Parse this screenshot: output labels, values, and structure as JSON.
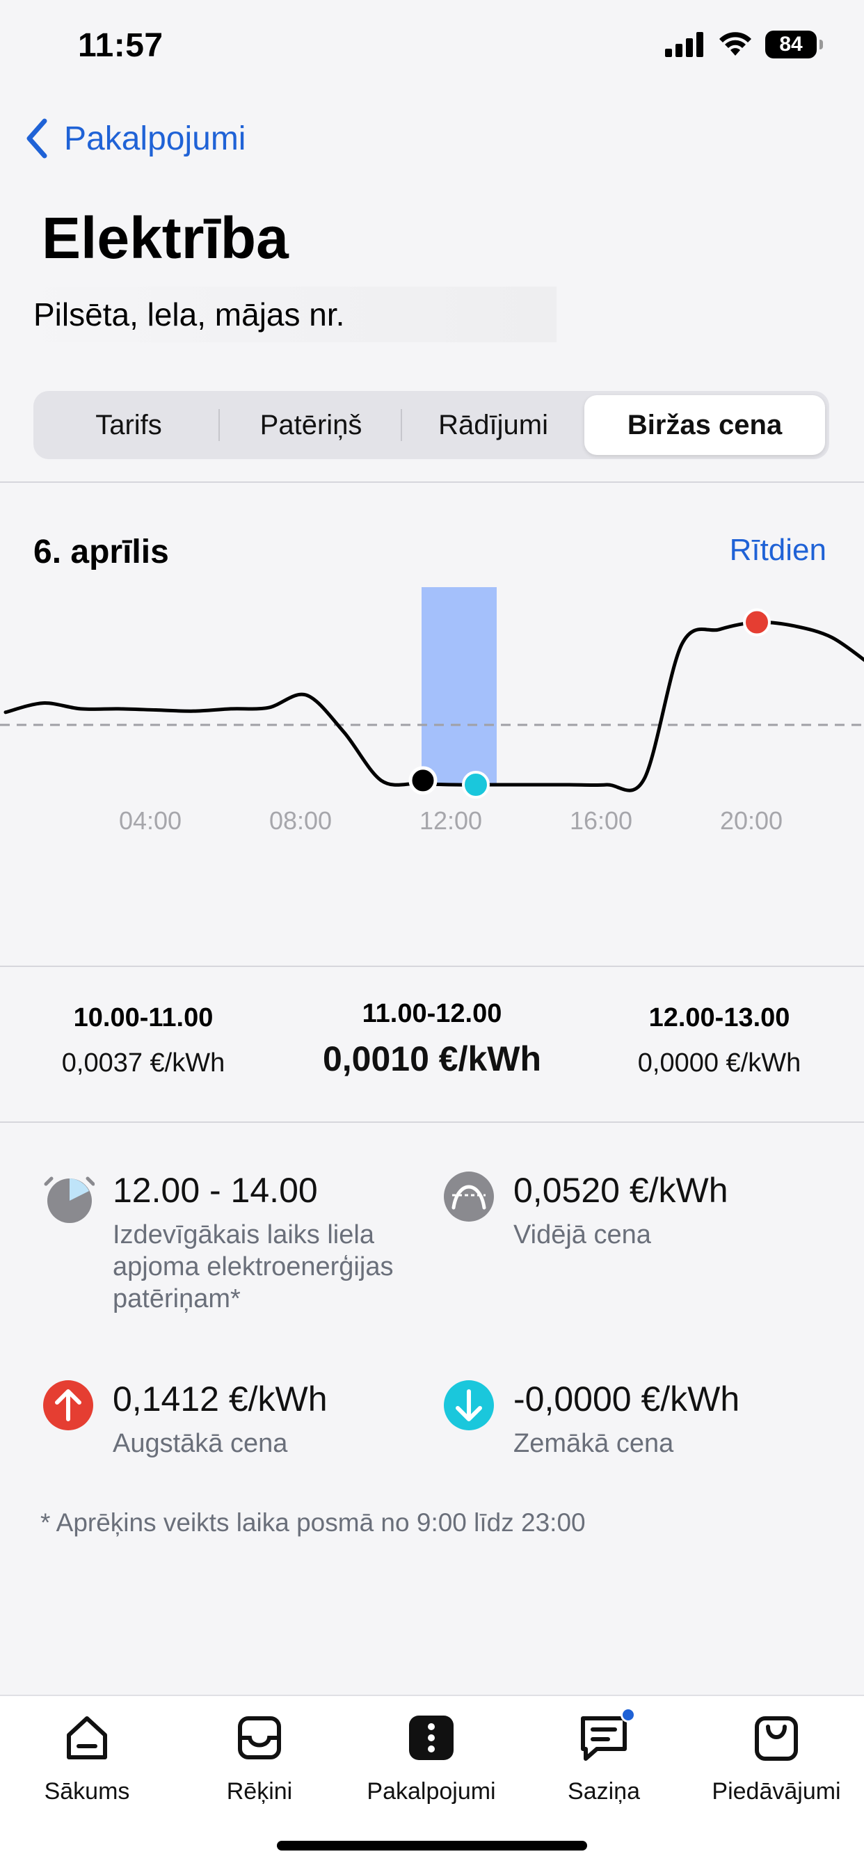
{
  "status_bar": {
    "time": "11:57",
    "battery": "84"
  },
  "nav": {
    "back_label": "Pakalpojumi",
    "title": "Elektrība",
    "address": "Pilsēta, lela, mājas nr."
  },
  "tabs": [
    {
      "label": "Tarifs",
      "active": false
    },
    {
      "label": "Patēriņš",
      "active": false
    },
    {
      "label": "Rādījumi",
      "active": false
    },
    {
      "label": "Biržas cena",
      "active": true
    }
  ],
  "chart_header": {
    "date": "6. aprīlis",
    "next_link": "Rītdien"
  },
  "chart_data": {
    "type": "line",
    "title": "",
    "xlabel": "",
    "ylabel": "",
    "x_unit": "hour",
    "tick_labels": [
      "04:00",
      "08:00",
      "12:00",
      "16:00",
      "20:00"
    ],
    "tick_hours": [
      4,
      8,
      12,
      16,
      20
    ],
    "xlim": [
      0,
      23
    ],
    "y_unit": "€/kWh",
    "ylim": [
      0,
      0.15
    ],
    "series": [
      {
        "x": [
          0,
          1,
          2,
          3,
          4,
          5,
          6,
          7,
          8,
          9,
          10,
          11,
          12,
          13,
          14,
          15,
          16,
          17,
          18,
          19,
          20,
          21,
          22,
          23
        ],
        "values": [
          0.063,
          0.071,
          0.066,
          0.066,
          0.065,
          0.064,
          0.066,
          0.067,
          0.078,
          0.046,
          0.0037,
          0.001,
          0.0,
          0.0,
          0.0,
          0.0,
          0.0,
          0.005,
          0.122,
          0.135,
          0.1412,
          0.138,
          0.128,
          0.105
        ]
      }
    ],
    "average": 0.052,
    "highlight_hour": 11,
    "selected_marker_hour": 10,
    "min_marker_hour": 12,
    "max_marker_hour": 20,
    "colors": {
      "line": "#000000",
      "highlight": "#a4c0fb",
      "max": "#e53e32",
      "min": "#1ac7dc",
      "average": "#a0a0a6"
    }
  },
  "hour_prices": [
    {
      "range": "10.00-11.00",
      "price": "0,0037 €/kWh"
    },
    {
      "range": "11.00-12.00",
      "price": "0,0010 €/kWh"
    },
    {
      "range": "12.00-13.00",
      "price": "0,0000 €/kWh"
    }
  ],
  "stats": {
    "best_time": {
      "value": "12.00 - 14.00",
      "label": "Izdevīgākais laiks liela apjoma elektroenerģijas patēriņam*",
      "icon": "clock-icon"
    },
    "average": {
      "value": "0,0520 €/kWh",
      "label": "Vidējā cena",
      "icon": "average-icon"
    },
    "max": {
      "value": "0,1412 €/kWh",
      "label": "Augstākā cena",
      "icon": "arrow-up-icon",
      "color": "#e53e32"
    },
    "min": {
      "value": "-0,0000 €/kWh",
      "label": "Zemākā cena",
      "icon": "arrow-down-icon",
      "color": "#1ac7dc"
    }
  },
  "footnote": "* Aprēķins veikts laika posmā no 9:00 līdz 23:00",
  "tabbar": [
    {
      "label": "Sākums",
      "icon": "home-icon"
    },
    {
      "label": "Rēķini",
      "icon": "inbox-icon"
    },
    {
      "label": "Pakalpojumi",
      "icon": "services-icon",
      "active": true
    },
    {
      "label": "Saziņa",
      "icon": "message-icon",
      "badge": true
    },
    {
      "label": "Piedāvājumi",
      "icon": "bag-icon"
    }
  ]
}
